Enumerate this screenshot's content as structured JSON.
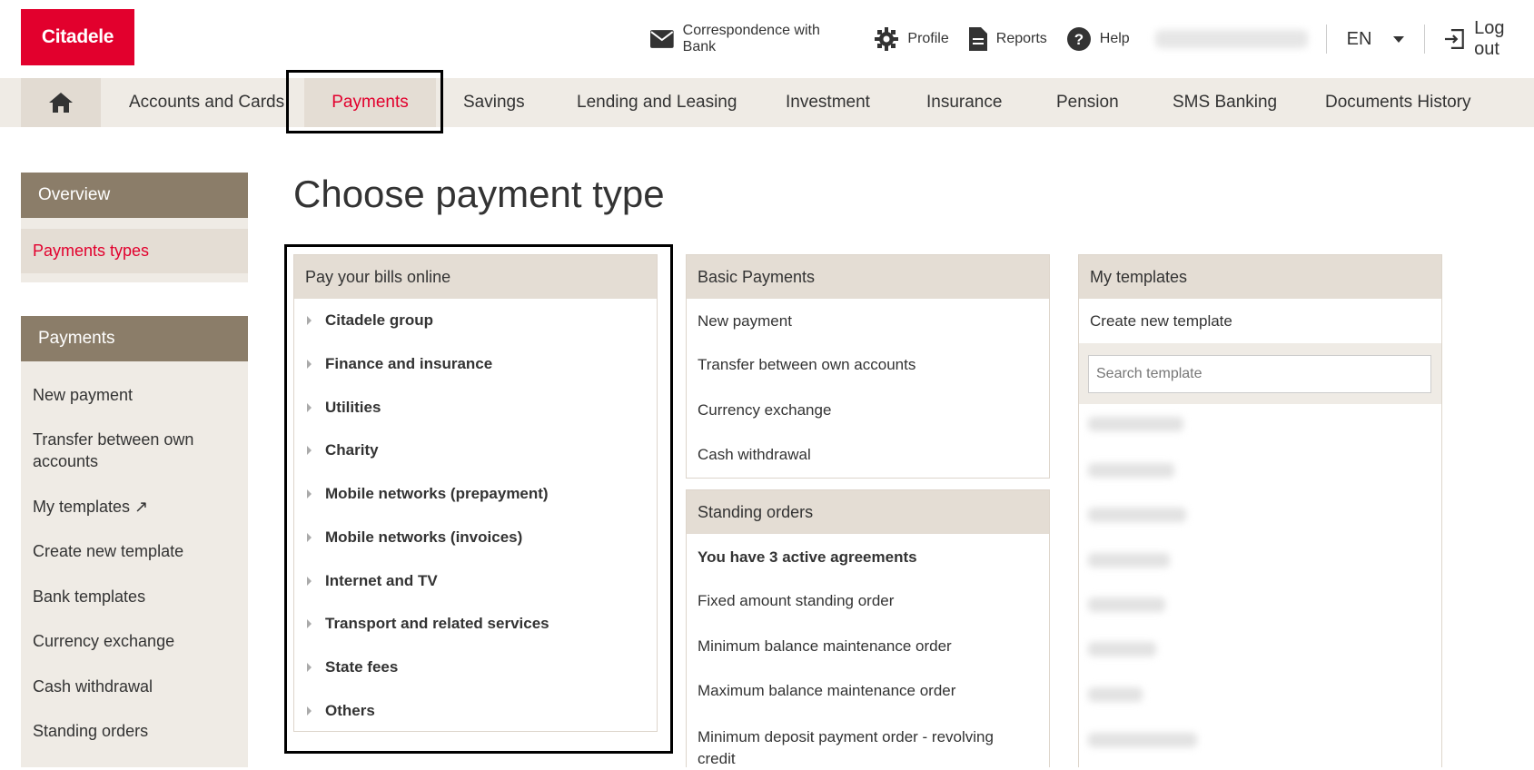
{
  "header": {
    "logo": "Citadele",
    "links": [
      {
        "label": "Correspondence with Bank",
        "icon": "envelope-icon"
      },
      {
        "label": "Profile",
        "icon": "gear-icon"
      },
      {
        "label": "Reports",
        "icon": "document-icon"
      },
      {
        "label": "Help",
        "icon": "help-icon"
      }
    ],
    "language": "EN",
    "logout": "Log out"
  },
  "nav": {
    "home_icon": "home-icon",
    "items": [
      "Accounts and Cards",
      "Payments",
      "Savings",
      "Lending and Leasing",
      "Investment",
      "Insurance",
      "Pension",
      "SMS Banking",
      "Documents History"
    ],
    "active": "Payments"
  },
  "sidebar": {
    "overview": {
      "title": "Overview",
      "items": [
        "Payments types"
      ]
    },
    "payments": {
      "title": "Payments",
      "items": [
        "New payment",
        "Transfer between own accounts",
        "My templates ↗",
        "Create new template",
        "Bank templates",
        "Currency exchange",
        "Cash withdrawal",
        "Standing orders"
      ]
    }
  },
  "main": {
    "title": "Choose payment type",
    "bills": {
      "title": "Pay your bills online",
      "items": [
        "Citadele group",
        "Finance and insurance",
        "Utilities",
        "Charity",
        "Mobile networks (prepayment)",
        "Mobile networks (invoices)",
        "Internet and TV",
        "Transport and related services",
        "State fees",
        "Others"
      ]
    },
    "basic": {
      "title": "Basic Payments",
      "items": [
        "New payment",
        "Transfer between own accounts",
        "Currency exchange",
        "Cash withdrawal"
      ]
    },
    "standing": {
      "title": "Standing orders",
      "agreements": "You have 3 active agreements",
      "items": [
        "Fixed amount standing order",
        "Minimum balance maintenance order",
        "Maximum balance maintenance order",
        "Minimum deposit payment order - revolving credit"
      ]
    },
    "templates": {
      "title": "My templates",
      "create": "Create new template",
      "search_placeholder": "Search template"
    }
  },
  "colors": {
    "brand": "#e2002d",
    "sidebar_head": "#8b7d69",
    "panel_head": "#e4ddd4",
    "nav_bg": "#efebe5"
  }
}
